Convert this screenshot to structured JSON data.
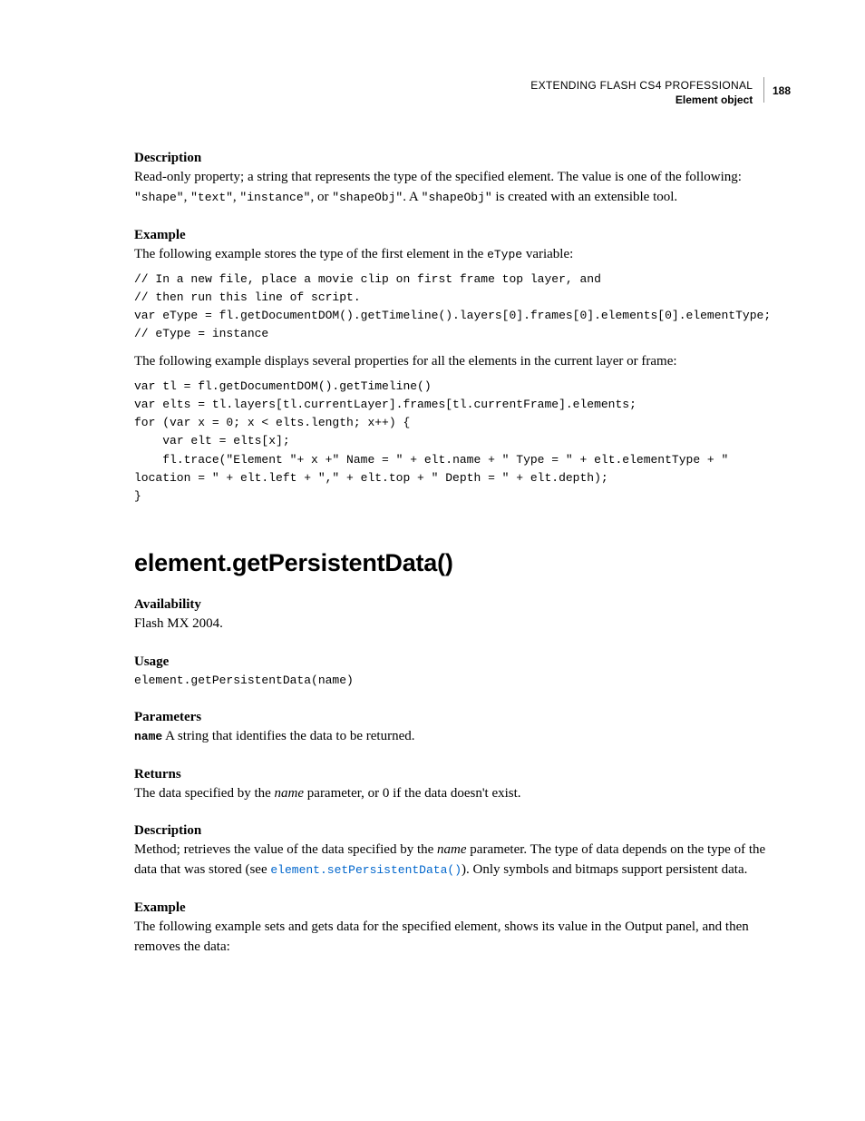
{
  "header": {
    "doc_title": "EXTENDING FLASH CS4 PROFESSIONAL",
    "section": "Element object",
    "page_number": "188"
  },
  "s1": {
    "label": "Description",
    "text_a": "Read-only property; a string that represents the type of the specified element. The value is one of the following: ",
    "code_a": "\"shape\"",
    "sep1": ", ",
    "code_b": "\"text\"",
    "sep2": ", ",
    "code_c": "\"instance\"",
    "sep3": ", or ",
    "code_d": "\"shapeObj\"",
    "sep4": ". A ",
    "code_e": "\"shapeObj\"",
    "text_b": " is created with an extensible tool."
  },
  "s2": {
    "label": "Example",
    "intro_a": "The following example stores the type of the first element in the ",
    "intro_code": "eType",
    "intro_b": " variable:",
    "code1": "// In a new file, place a movie clip on first frame top layer, and\n// then run this line of script.\nvar eType = fl.getDocumentDOM().getTimeline().layers[0].frames[0].elements[0].elementType; // eType = instance",
    "mid": "The following example displays several properties for all the elements in the current layer or frame:",
    "code2": "var tl = fl.getDocumentDOM().getTimeline()\nvar elts = tl.layers[tl.currentLayer].frames[tl.currentFrame].elements;\nfor (var x = 0; x < elts.length; x++) {\n    var elt = elts[x];\n    fl.trace(\"Element \"+ x +\" Name = \" + elt.name + \" Type = \" + elt.elementType + \" location = \" + elt.left + \",\" + elt.top + \" Depth = \" + elt.depth);\n}"
  },
  "method": {
    "title": "element.getPersistentData()"
  },
  "avail": {
    "label": "Availability",
    "text": "Flash MX 2004."
  },
  "usage": {
    "label": "Usage",
    "code": "element.getPersistentData(name)"
  },
  "params": {
    "label": "Parameters",
    "name": "name",
    "desc": "  A string that identifies the data to be returned."
  },
  "returns": {
    "label": "Returns",
    "text_a": "The data specified by the ",
    "italic": "name",
    "text_b": " parameter, or 0 if the data doesn't exist."
  },
  "desc2": {
    "label": "Description",
    "text_a": "Method; retrieves the value of the data specified by the ",
    "italic": "name",
    "text_b": " parameter. The type of data depends on the type of the data that was stored (see ",
    "link": "element.setPersistentData()",
    "text_c": "). Only symbols and bitmaps support persistent data."
  },
  "ex2": {
    "label": "Example",
    "text": "The following example sets and gets data for the specified element, shows its value in the Output panel, and then removes the data:"
  }
}
